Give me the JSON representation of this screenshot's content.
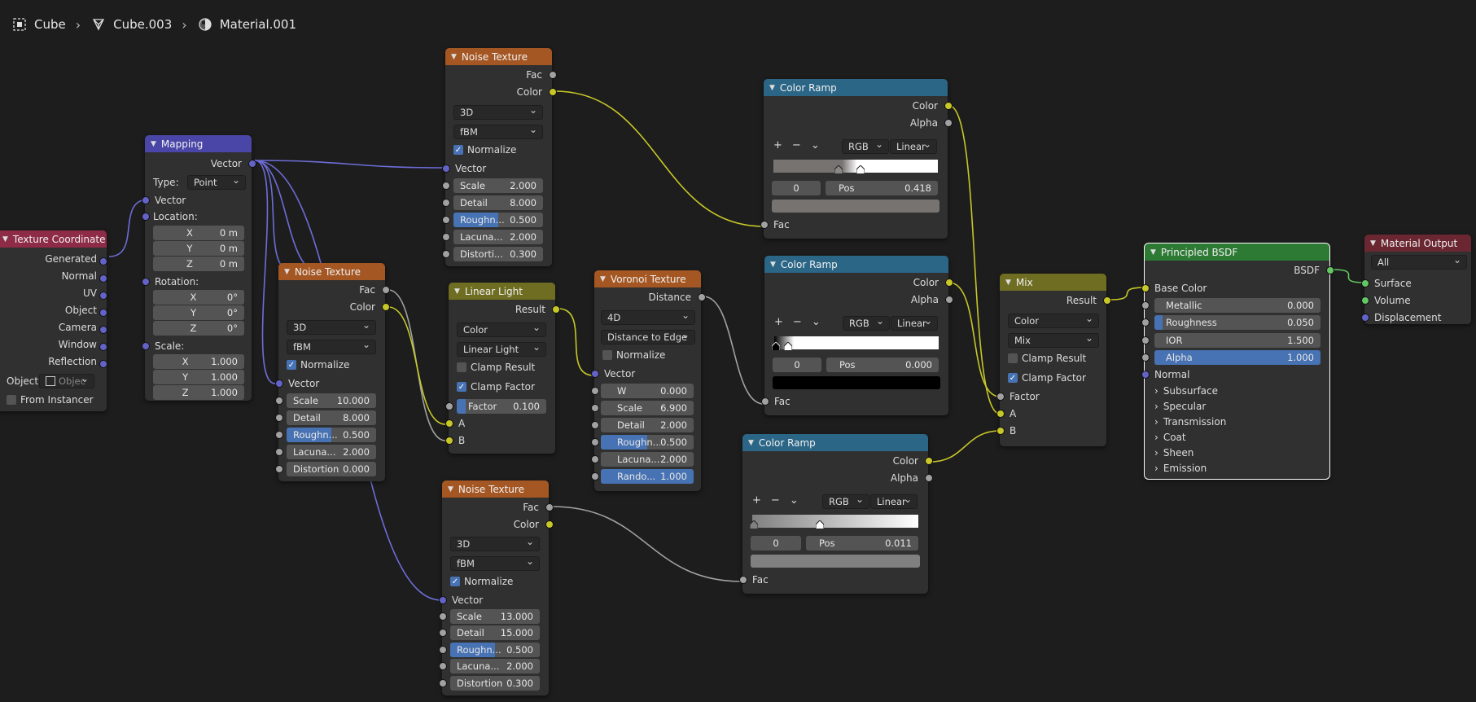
{
  "breadcrumb": {
    "object": "Cube",
    "mesh": "Cube.003",
    "material": "Material.001",
    "icons": [
      "object-icon",
      "mesh-icon",
      "material-icon"
    ]
  },
  "colors": {
    "socket_color": "#c7c729",
    "socket_float": "#a1a1a1",
    "socket_vector": "#6363c7",
    "socket_shader": "#63c763",
    "accent": "#4772b3"
  },
  "texcoord": {
    "title": "Texture Coordinate",
    "outputs": [
      "Generated",
      "Normal",
      "UV",
      "Object",
      "Camera",
      "Window",
      "Reflection"
    ],
    "object_label": "Object:",
    "object_placeholder": "Objec",
    "from_instancer": "From Instancer"
  },
  "mapping": {
    "title": "Mapping",
    "out_vector": "Vector",
    "type_label": "Type:",
    "type_value": "Point",
    "in_vector": "Vector",
    "location_label": "Location:",
    "location": [
      [
        "X",
        "0 m"
      ],
      [
        "Y",
        "0 m"
      ],
      [
        "Z",
        "0 m"
      ]
    ],
    "rotation_label": "Rotation:",
    "rotation": [
      [
        "X",
        "0°"
      ],
      [
        "Y",
        "0°"
      ],
      [
        "Z",
        "0°"
      ]
    ],
    "scale_label": "Scale:",
    "scale": [
      [
        "X",
        "1.000"
      ],
      [
        "Y",
        "1.000"
      ],
      [
        "Z",
        "1.000"
      ]
    ]
  },
  "noise1": {
    "title": "Noise Texture",
    "outputs": [
      "Fac",
      "Color"
    ],
    "dim": "3D",
    "type": "fBM",
    "normalize": "Normalize",
    "in_vector": "Vector",
    "fields": [
      {
        "label": "Scale",
        "value": "2.000",
        "fill": 0
      },
      {
        "label": "Detail",
        "value": "8.000",
        "fill": 0
      },
      {
        "label": "Roughn...",
        "value": "0.500",
        "fill": 0.5
      },
      {
        "label": "Lacuna...",
        "value": "2.000",
        "fill": 0
      },
      {
        "label": "Distorti...",
        "value": "0.300",
        "fill": 0
      }
    ]
  },
  "noise2": {
    "title": "Noise Texture",
    "outputs": [
      "Fac",
      "Color"
    ],
    "dim": "3D",
    "type": "fBM",
    "normalize": "Normalize",
    "in_vector": "Vector",
    "fields": [
      {
        "label": "Scale",
        "value": "10.000",
        "fill": 0
      },
      {
        "label": "Detail",
        "value": "8.000",
        "fill": 0
      },
      {
        "label": "Roughn...",
        "value": "0.500",
        "fill": 0.5
      },
      {
        "label": "Lacuna...",
        "value": "2.000",
        "fill": 0
      },
      {
        "label": "Distortion",
        "value": "0.000",
        "fill": 0
      }
    ]
  },
  "noise3": {
    "title": "Noise Texture",
    "outputs": [
      "Fac",
      "Color"
    ],
    "dim": "3D",
    "type": "fBM",
    "normalize": "Normalize",
    "in_vector": "Vector",
    "fields": [
      {
        "label": "Scale",
        "value": "13.000",
        "fill": 0
      },
      {
        "label": "Detail",
        "value": "15.000",
        "fill": 0
      },
      {
        "label": "Roughn...",
        "value": "0.500",
        "fill": 0.5
      },
      {
        "label": "Lacuna...",
        "value": "2.000",
        "fill": 0
      },
      {
        "label": "Distortion",
        "value": "0.300",
        "fill": 0
      }
    ]
  },
  "linearlight": {
    "title": "Linear Light",
    "out_result": "Result",
    "data_type": "Color",
    "blend": "Linear Light",
    "clamp_result": "Clamp Result",
    "clamp_factor": "Clamp Factor",
    "factor_label": "Factor",
    "factor_value": "0.100",
    "factor_fill": 0.1,
    "in_a": "A",
    "in_b": "B"
  },
  "voronoi": {
    "title": "Voronoi Texture",
    "out_distance": "Distance",
    "dim": "4D",
    "feature": "Distance to Edge",
    "normalize": "Normalize",
    "in_vector": "Vector",
    "fields": [
      {
        "label": "W",
        "value": "0.000",
        "fill": 0
      },
      {
        "label": "Scale",
        "value": "6.900",
        "fill": 0
      },
      {
        "label": "Detail",
        "value": "2.000",
        "fill": 0
      },
      {
        "label": "Roughn...",
        "value": "0.500",
        "fill": 0.5
      },
      {
        "label": "Lacuna...",
        "value": "2.000",
        "fill": 0
      },
      {
        "label": "Rando...",
        "value": "1.000",
        "fill": 1
      }
    ]
  },
  "ramp1": {
    "title": "Color Ramp",
    "outputs": [
      "Color",
      "Alpha"
    ],
    "tools": [
      "+",
      "−",
      "⌄"
    ],
    "mode": "RGB",
    "interp": "Linear",
    "index": "0",
    "pos_label": "Pos",
    "pos_value": "0.418",
    "stop_color": "#777370",
    "in_fac": "Fac"
  },
  "ramp2": {
    "title": "Color Ramp",
    "outputs": [
      "Color",
      "Alpha"
    ],
    "tools": [
      "+",
      "−",
      "⌄"
    ],
    "mode": "RGB",
    "interp": "Linear",
    "index": "0",
    "pos_label": "Pos",
    "pos_value": "0.000",
    "stop_color": "#000000",
    "in_fac": "Fac"
  },
  "ramp3": {
    "title": "Color Ramp",
    "outputs": [
      "Color",
      "Alpha"
    ],
    "tools": [
      "+",
      "−",
      "⌄"
    ],
    "mode": "RGB",
    "interp": "Linear",
    "index": "0",
    "pos_label": "Pos",
    "pos_value": "0.011",
    "stop_color": "#808080",
    "in_fac": "Fac"
  },
  "mix": {
    "title": "Mix",
    "out_result": "Result",
    "data_type": "Color",
    "blend": "Mix",
    "clamp_result": "Clamp Result",
    "clamp_factor": "Clamp Factor",
    "in_factor": "Factor",
    "in_a": "A",
    "in_b": "B"
  },
  "bsdf": {
    "title": "Principled BSDF",
    "out_bsdf": "BSDF",
    "base_color": "Base Color",
    "fields": [
      {
        "label": "Metallic",
        "value": "0.000",
        "fill": 0
      },
      {
        "label": "Roughness",
        "value": "0.050",
        "fill": 0.05
      },
      {
        "label": "IOR",
        "value": "1.500",
        "fill": 0
      },
      {
        "label": "Alpha",
        "value": "1.000",
        "fill": 1
      }
    ],
    "normal": "Normal",
    "panels": [
      "Subsurface",
      "Specular",
      "Transmission",
      "Coat",
      "Sheen",
      "Emission"
    ]
  },
  "output": {
    "title": "Material Output",
    "target": "All",
    "inputs": [
      "Surface",
      "Volume",
      "Displacement"
    ]
  }
}
